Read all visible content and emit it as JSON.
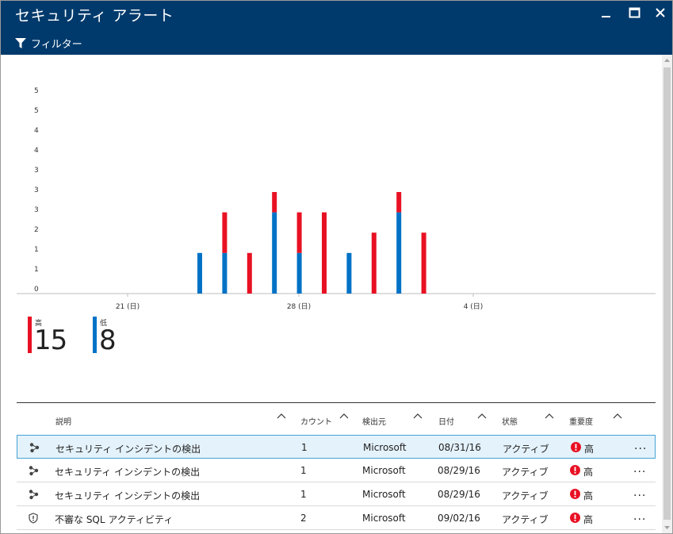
{
  "window": {
    "title": "セキュリティ アラート",
    "filter_label": "フィルター"
  },
  "chart_data": {
    "type": "bar",
    "stacked": true,
    "y_ticks": [
      "0",
      "1",
      "1",
      "2",
      "3",
      "3",
      "3",
      "4",
      "4",
      "5",
      "5"
    ],
    "x_tick_labels": [
      "21 (日)",
      "28 (日)",
      "4 (日)"
    ],
    "ylim": [
      0,
      5
    ],
    "categories": [
      "24",
      "25",
      "26",
      "27",
      "28",
      "29",
      "30",
      "31",
      "1",
      "2"
    ],
    "series": [
      {
        "name": "低",
        "color": "#0072c6",
        "values": [
          1,
          1,
          0,
          2,
          1,
          0,
          1,
          0,
          2,
          0
        ]
      },
      {
        "name": "高",
        "color": "#e81123",
        "values": [
          0,
          1,
          1,
          0.5,
          1,
          2,
          0,
          1.5,
          0.5,
          1.5
        ]
      }
    ],
    "grid": false
  },
  "summary": [
    {
      "label": "高",
      "count": "15",
      "color": "#e81123"
    },
    {
      "label": "低",
      "count": "8",
      "color": "#0072c6"
    }
  ],
  "table": {
    "headers": {
      "description": "説明",
      "count": "カウント",
      "source": "検出元",
      "date": "日付",
      "state": "状態",
      "severity": "重要度"
    },
    "rows": [
      {
        "icon": "incident-icon",
        "description": "セキュリティ インシデントの検出",
        "count": "1",
        "source": "Microsoft",
        "date": "08/31/16",
        "state": "アクティブ",
        "severity": "高",
        "more": "..."
      },
      {
        "icon": "incident-icon",
        "description": "セキュリティ インシデントの検出",
        "count": "1",
        "source": "Microsoft",
        "date": "08/29/16",
        "state": "アクティブ",
        "severity": "高",
        "more": "..."
      },
      {
        "icon": "incident-icon",
        "description": "セキュリティ インシデントの検出",
        "count": "1",
        "source": "Microsoft",
        "date": "08/29/16",
        "state": "アクティブ",
        "severity": "高",
        "more": "..."
      },
      {
        "icon": "shield-icon",
        "description": "不審な SQL アクティビティ",
        "count": "2",
        "source": "Microsoft",
        "date": "09/02/16",
        "state": "アクティブ",
        "severity": "高",
        "more": "..."
      }
    ]
  },
  "colors": {
    "titlebar": "#003a6c",
    "high": "#e81123",
    "low": "#0072c6",
    "selected_row": "#e4f2fb"
  }
}
